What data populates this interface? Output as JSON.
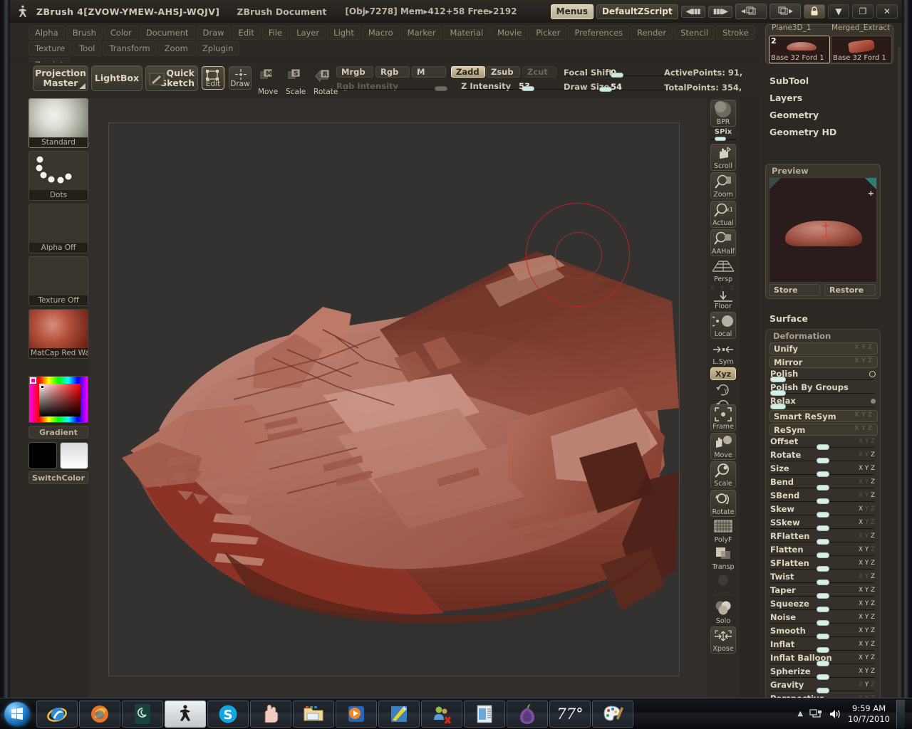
{
  "titlebar": {
    "app_title": "ZBrush 4[ZVOW-YMEW-AHSJ-WQJV]",
    "document_title": "ZBrush Document",
    "stats": "[Obj▸7278] Mem▸412+58 Free▸2192",
    "menus_label": "Menus",
    "zscript_label": "DefaultZScript",
    "prev_arrow": "◀▮▮▮",
    "next_arrow": "▮▮▮▶",
    "doc_prev": "◀",
    "doc_next": "▶",
    "lock_icon": "lock-icon",
    "minimize_label": "▼",
    "restore_label": "❐",
    "close_label": "✕"
  },
  "menubar": {
    "row1": [
      "Alpha",
      "Brush",
      "Color",
      "Document",
      "Draw",
      "Edit",
      "File",
      "Layer",
      "Light",
      "Macro",
      "Marker",
      "Material",
      "Movie",
      "Picker",
      "Preferences",
      "Render",
      "Stencil",
      "Stroke",
      "Texture",
      "Tool",
      "Transform",
      "Zoom",
      "Zplugin"
    ],
    "row2": [
      "Zscript"
    ]
  },
  "shelf": {
    "projection_master": "Projection\nMaster",
    "projection_master_l1": "Projection",
    "projection_master_l2": "Master",
    "lightbox": "LightBox",
    "quick_sketch_l1": "Quick",
    "quick_sketch_l2": "Sketch",
    "edit": "Edit",
    "draw": "Draw",
    "move": "Move",
    "scale": "Scale",
    "rotate": "Rotate",
    "mrgb": "Mrgb",
    "rgb": "Rgb",
    "m": "M",
    "zadd": "Zadd",
    "zsub": "Zsub",
    "zcut": "Zcut",
    "rgb_intensity_label": "Rgb Intensity",
    "rgb_intensity_value": "100",
    "z_intensity_label": "Z Intensity",
    "z_intensity_value": "53",
    "focal_shift_label": "Focal Shift",
    "focal_shift_value": "0",
    "draw_size_label": "Draw Size",
    "draw_size_value": "54",
    "active_points": "ActivePoints: 91,",
    "total_points": "TotalPoints: 354,"
  },
  "left_palette": {
    "brush": {
      "name": "Standard",
      "icon": "brush-swirl-icon"
    },
    "stroke": {
      "name": "Dots",
      "icon": "stroke-dots-icon"
    },
    "alpha": {
      "name": "Alpha Off",
      "icon": "alpha-icon"
    },
    "texture": {
      "name": "Texture Off",
      "icon": "texture-icon"
    },
    "material": {
      "name": "MatCap Red Wa",
      "icon": "material-sphere-icon"
    },
    "gradient_label": "Gradient",
    "switchcolor_label": "SwitchColor"
  },
  "canvas": {
    "model_name": "sculpt-mesh",
    "brush_cursor": "brush-cursor-ring",
    "background_color": "#333231"
  },
  "right_strip": {
    "bpr": "BPR",
    "spix_label": "SPix",
    "items": [
      {
        "label": "Scroll",
        "icon": "scroll-hand-icon"
      },
      {
        "label": "Zoom",
        "icon": "zoom-magnifier-icon"
      },
      {
        "label": "Actual",
        "icon": "actual-size-icon"
      },
      {
        "label": "AAHalf",
        "icon": "antialias-half-icon"
      },
      {
        "label": "Persp",
        "icon": "perspective-grid-icon"
      },
      {
        "label": "Floor",
        "icon": "floor-grid-icon"
      },
      {
        "label": "Local",
        "icon": "local-symmetry-icon"
      },
      {
        "label": "L.Sym",
        "icon": "local-sym-arrows-icon"
      },
      {
        "label": "Xyz",
        "icon": "xyz-axis-icon"
      },
      {
        "label": "Frame",
        "icon": "frame-icon"
      },
      {
        "label": "Move",
        "icon": "move-hand-icon"
      },
      {
        "label": "Scale",
        "icon": "scale-magnifier-icon"
      },
      {
        "label": "Rotate",
        "icon": "rotate-icon"
      },
      {
        "label": "PolyF",
        "icon": "polyframe-icon"
      },
      {
        "label": "Transp",
        "icon": "transparency-icon"
      },
      {
        "label": "Ghost",
        "icon": "ghost-icon"
      },
      {
        "label": "Solo",
        "icon": "solo-icon"
      },
      {
        "label": "Xpose",
        "icon": "xpose-icon"
      }
    ],
    "floor_axes": "X Y Z",
    "rot_y_icon": "rotate-y-icon",
    "rot_z_icon": "rotate-z-icon"
  },
  "right_panel": {
    "tool_tabs": [
      "Plane3D_1",
      "Merged_Extract"
    ],
    "tool_cells": [
      {
        "number": "2",
        "label": "Base 32 Ford 1",
        "selected": true
      },
      {
        "number": "",
        "label": "Base 32 Ford 1",
        "selected": false
      }
    ],
    "sections": [
      "SubTool",
      "Layers",
      "Geometry",
      "Geometry HD"
    ],
    "preview": {
      "title": "Preview",
      "store_label": "Store",
      "restore_label": "Restore"
    },
    "surface_label": "Surface",
    "deformation": {
      "title": "Deformation",
      "buttons": [
        {
          "label": "Unify",
          "axes": "X Y Z",
          "axes_on": [
            false,
            false,
            false
          ]
        },
        {
          "label": "Mirror",
          "axes": "X Y Z",
          "axes_on": [
            false,
            false,
            false
          ]
        }
      ],
      "toggles": [
        {
          "label": "Polish",
          "marker": "circle-outline"
        },
        {
          "label": "Polish By Groups",
          "marker": "none"
        },
        {
          "label": "Relax",
          "marker": "circle-filled"
        }
      ],
      "big_buttons": [
        {
          "label": "Smart ReSym",
          "axes": "X Y Z"
        },
        {
          "label": "ReSym",
          "axes": "X Y Z"
        }
      ],
      "sliders": [
        {
          "label": "Offset",
          "axes": "X Y Z",
          "axes_on": [
            false,
            false,
            false
          ]
        },
        {
          "label": "Rotate",
          "axes": "X Y Z",
          "axes_on": [
            false,
            false,
            true
          ]
        },
        {
          "label": "Size",
          "axes": "X Y Z",
          "axes_on": [
            true,
            true,
            true
          ]
        },
        {
          "label": "Bend",
          "axes": "X Y Z",
          "axes_on": [
            false,
            false,
            true
          ]
        },
        {
          "label": "SBend",
          "axes": "X Y Z",
          "axes_on": [
            false,
            false,
            true
          ]
        },
        {
          "label": "Skew",
          "axes": "X Y Z",
          "axes_on": [
            true,
            false,
            false
          ]
        },
        {
          "label": "SSkew",
          "axes": "X Y Z",
          "axes_on": [
            true,
            false,
            false
          ]
        },
        {
          "label": "RFlatten",
          "axes": "X Y Z",
          "axes_on": [
            false,
            false,
            true
          ]
        },
        {
          "label": "Flatten",
          "axes": "X Y Z",
          "axes_on": [
            true,
            true,
            false
          ]
        },
        {
          "label": "SFlatten",
          "axes": "X Y Z",
          "axes_on": [
            true,
            true,
            true
          ]
        },
        {
          "label": "Twist",
          "axes": "X Y Z",
          "axes_on": [
            false,
            false,
            true
          ]
        },
        {
          "label": "Taper",
          "axes": "X Y Z",
          "axes_on": [
            true,
            true,
            true
          ]
        },
        {
          "label": "Squeeze",
          "axes": "X Y Z",
          "axes_on": [
            true,
            true,
            true
          ]
        },
        {
          "label": "Noise",
          "axes": "X Y Z",
          "axes_on": [
            true,
            true,
            true
          ]
        },
        {
          "label": "Smooth",
          "axes": "X Y Z",
          "axes_on": [
            true,
            true,
            true
          ]
        },
        {
          "label": "Inflat",
          "axes": "X Y Z",
          "axes_on": [
            true,
            true,
            true
          ]
        },
        {
          "label": "Inflat Balloon",
          "axes": "X Y Z",
          "axes_on": [
            true,
            true,
            true
          ]
        },
        {
          "label": "Spherize",
          "axes": "X Y Z",
          "axes_on": [
            true,
            true,
            true
          ]
        },
        {
          "label": "Gravity",
          "axes": "X Y Z",
          "axes_on": [
            false,
            true,
            false
          ]
        },
        {
          "label": "Perspective",
          "axes": "X Y Z",
          "axes_on": [
            false,
            false,
            false
          ]
        }
      ]
    }
  },
  "taskbar": {
    "start_label": "start-orb",
    "items": [
      {
        "name": "internet-explorer-icon",
        "state": "open"
      },
      {
        "name": "firefox-icon",
        "state": "open"
      },
      {
        "name": "evernote-icon",
        "state": "open"
      },
      {
        "name": "zbrush-icon",
        "state": "active"
      },
      {
        "name": "skype-icon",
        "state": "open"
      },
      {
        "name": "hand-app-icon",
        "state": "open"
      },
      {
        "name": "explorer-folder-icon",
        "state": "open"
      },
      {
        "name": "media-player-icon",
        "state": "open"
      },
      {
        "name": "paint-shop-icon",
        "state": "open"
      },
      {
        "name": "contacts-icon",
        "state": "open"
      },
      {
        "name": "notepad-icon",
        "state": "open"
      },
      {
        "name": "tor-onion-icon",
        "state": "open"
      },
      {
        "name": "weather-icon",
        "state": "open",
        "label": "77°"
      },
      {
        "name": "paint-palette-icon",
        "state": "open"
      }
    ],
    "weather_temp": "77°",
    "tray": {
      "show_hidden": "▲",
      "network_icon": "network-icon",
      "volume_icon": "volume-icon",
      "time": "9:59 AM",
      "date": "10/7/2010"
    }
  }
}
